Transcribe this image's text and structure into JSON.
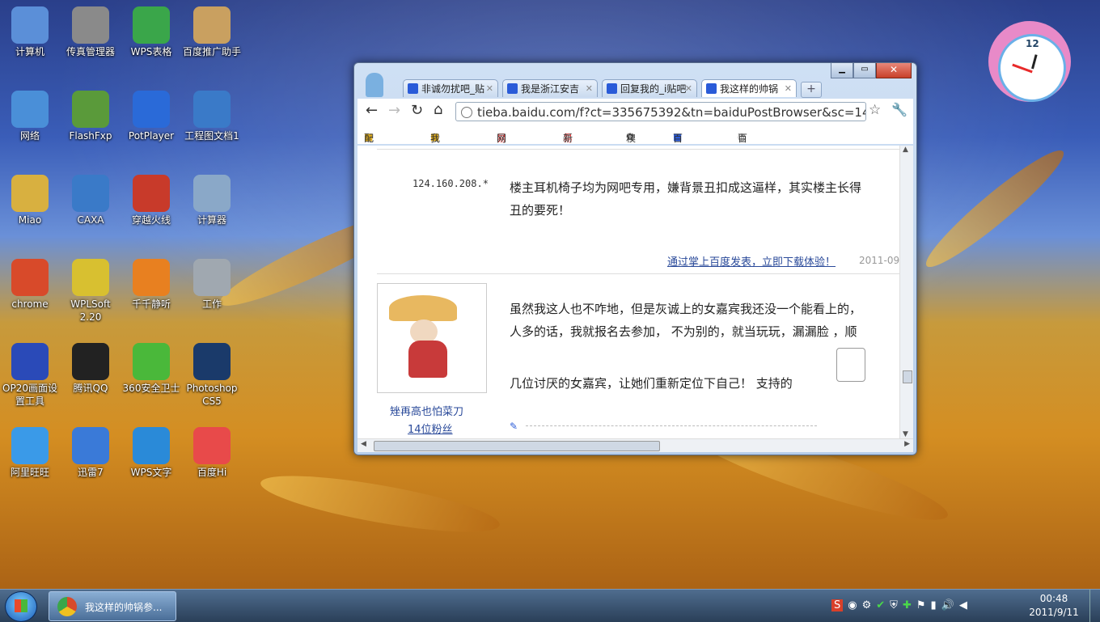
{
  "desktop_icons": [
    {
      "label": "计算机",
      "icon": "computer-icon",
      "color": "#5b8fd8"
    },
    {
      "label": "传真管理器",
      "icon": "fax-icon",
      "color": "#8a8a8a"
    },
    {
      "label": "WPS表格",
      "icon": "wps-sheet-icon",
      "color": "#3aa64a"
    },
    {
      "label": "百度推广助手",
      "icon": "baidu-tool-icon",
      "color": "#c9a060"
    },
    {
      "label": "网络",
      "icon": "network-icon",
      "color": "#4a8fd8"
    },
    {
      "label": "FlashFxp",
      "icon": "flashfxp-icon",
      "color": "#5a9a3a"
    },
    {
      "label": "PotPlayer",
      "icon": "potplayer-icon",
      "color": "#2a6ad8"
    },
    {
      "label": "工程图文档1",
      "icon": "caxa-doc-icon",
      "color": "#3a7ac8"
    },
    {
      "label": "Miao",
      "icon": "user-folder-icon",
      "color": "#d8b040"
    },
    {
      "label": "CAXA",
      "icon": "caxa-icon",
      "color": "#3a7ac8"
    },
    {
      "label": "穿越火线",
      "icon": "crossfire-icon",
      "color": "#c83a2a"
    },
    {
      "label": "计算器",
      "icon": "calculator-icon",
      "color": "#8aa8c8"
    },
    {
      "label": "chrome",
      "icon": "chrome-icon",
      "color": "#d84a2a"
    },
    {
      "label": "WPLSoft 2.20",
      "icon": "wplsoft-icon",
      "color": "#d8c030"
    },
    {
      "label": "千千静听",
      "icon": "ttplayer-icon",
      "color": "#e88020"
    },
    {
      "label": "工作",
      "icon": "drive-icon",
      "color": "#a0a8b0"
    },
    {
      "label": "OP20画面设置工具",
      "icon": "op20-icon",
      "color": "#2a4ab8"
    },
    {
      "label": "腾讯QQ",
      "icon": "qq-icon",
      "color": "#222222"
    },
    {
      "label": "360安全卫士",
      "icon": "360-icon",
      "color": "#4ab83a"
    },
    {
      "label": "Photoshop CS5",
      "icon": "photoshop-icon",
      "color": "#1a3a6a"
    },
    {
      "label": "阿里旺旺",
      "icon": "aliwangwang-icon",
      "color": "#3a9ae8"
    },
    {
      "label": "迅雷7",
      "icon": "xunlei-icon",
      "color": "#3a7ad8"
    },
    {
      "label": "WPS文字",
      "icon": "wps-writer-icon",
      "color": "#2a8ad8"
    },
    {
      "label": "百度Hi",
      "icon": "baiduhi-icon",
      "color": "#e84a4a"
    }
  ],
  "browser": {
    "tabs": [
      {
        "label": "非诚勿扰吧_贴"
      },
      {
        "label": "我是浙江安吉"
      },
      {
        "label": "回复我的_i贴吧"
      },
      {
        "label": "我这样的帅锅"
      }
    ],
    "new_tab": "+",
    "address": "tieba.baidu.com/f?ct=335675392&tn=baiduPostBrowser&sc=142",
    "bookmarks": [
      "配件厂商",
      "我的网站",
      "网易新闻",
      "新闻排行",
      "糗百",
      "百度一下",
      "百度推广"
    ],
    "post1": {
      "ip": "124.160.208.*",
      "text_line1": "楼主耳机椅子均为网吧专用，嫌背景丑扣成这逼样，其实楼主长得",
      "text_line2": "丑的要死！",
      "footer_link": "通过掌上百度发表，立即下载体验！",
      "footer_date": "2011-09"
    },
    "post2": {
      "username": "矬再高也怕菜刀",
      "fans": "14位粉丝",
      "text_line1": "虽然我这人也不咋地，但是灰诚上的女嘉宾我还没一个能看上的，",
      "text_line2": "人多的话，我就报名去参加，  不为别的，就当玩玩，漏漏脸 ，顺",
      "text_line3": "几位讨厌的女嘉宾，让她们重新定位下自己！   支持的"
    }
  },
  "clock_widget": {
    "number": "12"
  },
  "taskbar": {
    "task_label": "我这样的帅锅参...",
    "time": "00:48",
    "date": "2011/9/11"
  }
}
